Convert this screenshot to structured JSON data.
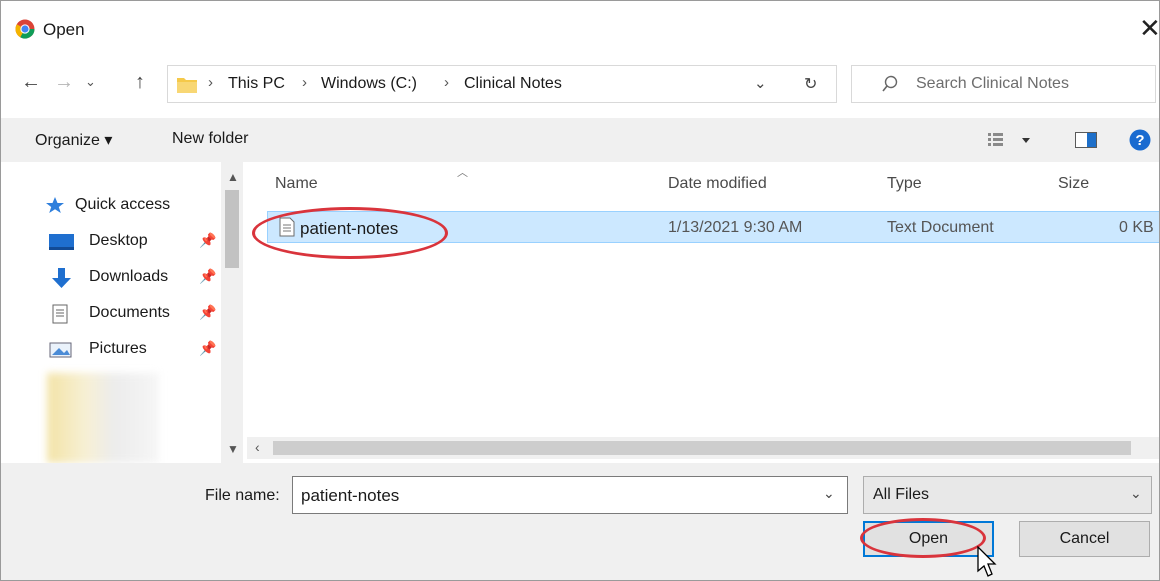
{
  "window": {
    "title": "Open",
    "close_glyph": "✕"
  },
  "address": {
    "crumbs": [
      "This PC",
      "Windows (C:)",
      "Clinical Notes"
    ],
    "search_placeholder": "Search Clinical Notes"
  },
  "toolbar": {
    "organize_label": "Organize ▾",
    "new_folder_label": "New folder"
  },
  "nav": {
    "quick_access": "Quick access",
    "items": [
      {
        "label": "Desktop"
      },
      {
        "label": "Downloads"
      },
      {
        "label": "Documents"
      },
      {
        "label": "Pictures"
      }
    ]
  },
  "columns": {
    "name": "Name",
    "date": "Date modified",
    "type": "Type",
    "size": "Size"
  },
  "files": [
    {
      "name": "patient-notes",
      "date": "1/13/2021 9:30 AM",
      "type": "Text Document",
      "size": "0 KB"
    }
  ],
  "footer": {
    "file_name_label": "File name:",
    "file_name_value": "patient-notes",
    "file_type": "All Files",
    "open_label": "Open",
    "cancel_label": "Cancel"
  },
  "colors": {
    "accent": "#0078d7",
    "selection": "#cce8ff",
    "highlight_ring": "#d9343c"
  }
}
